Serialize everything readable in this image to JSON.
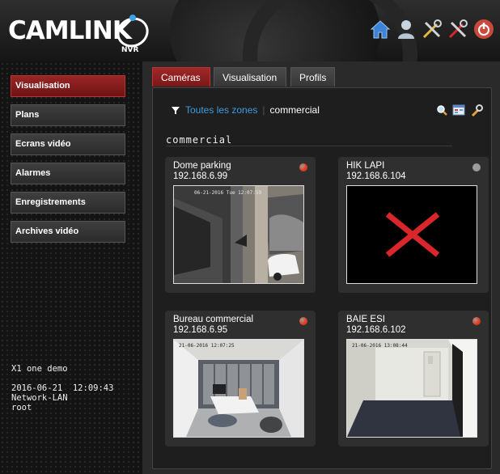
{
  "header": {
    "logo_text": "CAMLINK",
    "logo_sub": "NVR",
    "icons": [
      "home-icon",
      "user-icon",
      "tools-icon",
      "tools-x-icon",
      "power-icon"
    ]
  },
  "sidebar": {
    "items": [
      {
        "label": "Visualisation",
        "active": true
      },
      {
        "label": "Plans",
        "active": false
      },
      {
        "label": "Ecrans vidéo",
        "active": false
      },
      {
        "label": "Alarmes",
        "active": false
      },
      {
        "label": "Enregistrements",
        "active": false
      },
      {
        "label": "Archives vidéo",
        "active": false
      }
    ],
    "system_name": "X1 one demo",
    "datetime": "2016-06-21  12:09:43",
    "network": "Network-LAN",
    "user": "root"
  },
  "tabs": [
    {
      "label": "Caméras",
      "active": true
    },
    {
      "label": "Visualisation",
      "active": false
    },
    {
      "label": "Profils",
      "active": false
    }
  ],
  "filter": {
    "all_zones": "Toutes les zones",
    "separator": "|",
    "current_zone": "commercial"
  },
  "toolbar_icons": [
    "search-icon",
    "grid-view-icon",
    "wrench-icon"
  ],
  "section_title": "commercial",
  "cameras": [
    {
      "name": "Dome parking",
      "ip": "192.168.6.99",
      "status_color": "#e23a1c",
      "timestamp": "06-21-2016 Tue 12:07:59"
    },
    {
      "name": "HIK LAPI",
      "ip": "192.168.6.104",
      "status_color": "#9a9a9a",
      "timestamp": ""
    },
    {
      "name": "Bureau commercial",
      "ip": "192.168.6.95",
      "status_color": "#e23a1c",
      "timestamp": "21-06-2016 12:07:25"
    },
    {
      "name": "BAIE ESI",
      "ip": "192.168.6.102",
      "status_color": "#e23a1c",
      "timestamp": "21-06-2016 13:08:44"
    }
  ],
  "colors": {
    "accent_red": "#8c1c1c",
    "link_blue": "#3f9bdf",
    "offline_cross": "#d8262b"
  }
}
